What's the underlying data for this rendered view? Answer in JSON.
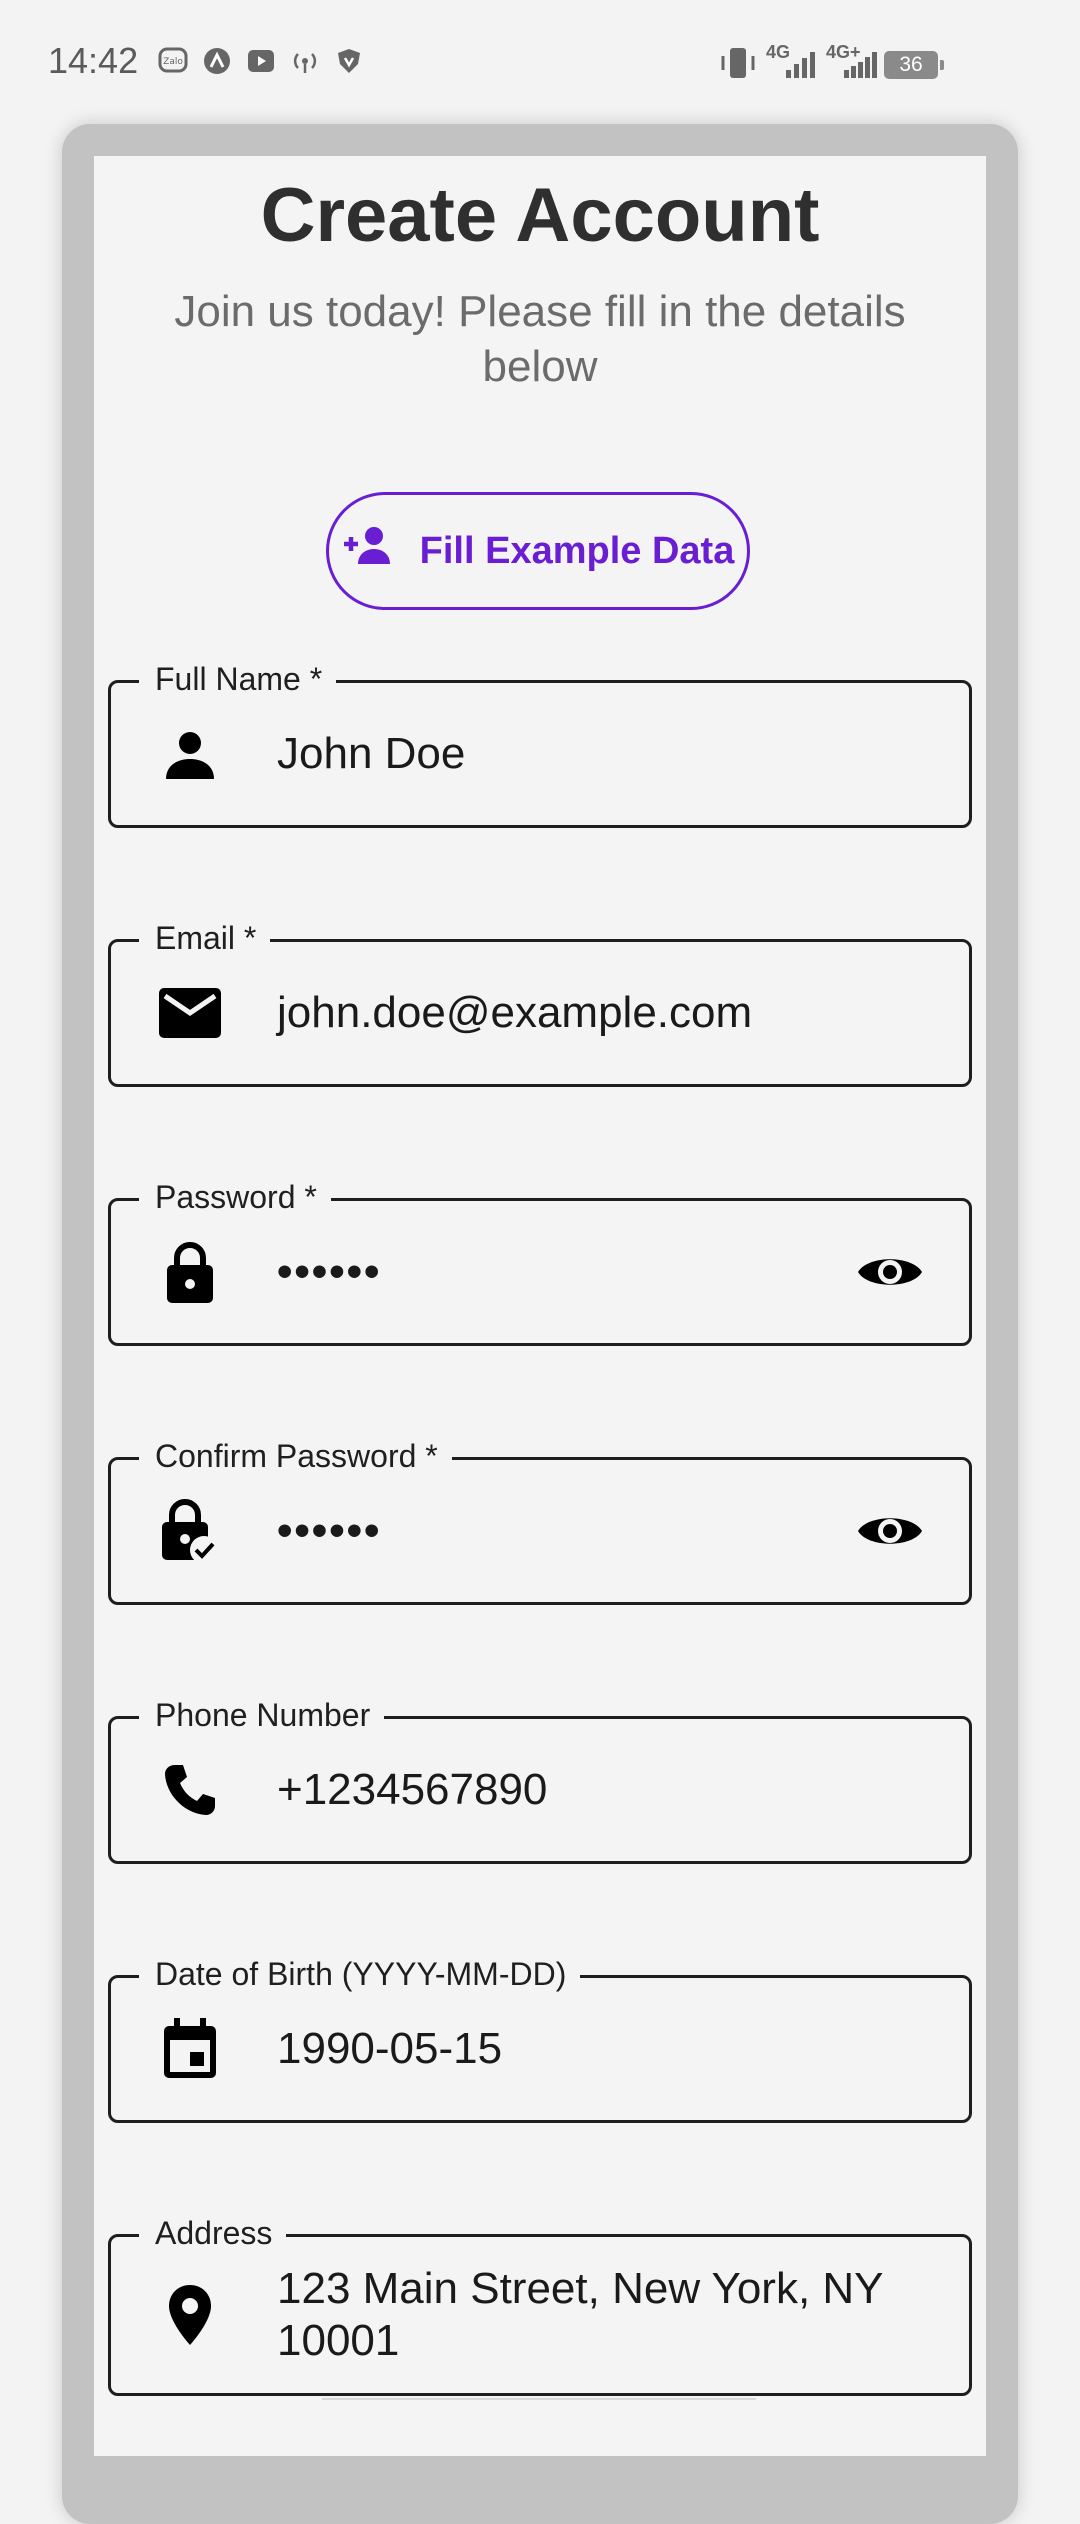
{
  "status": {
    "time": "14:42",
    "battery": "36",
    "net1": "4G",
    "net2": "4G+",
    "zalo_label": "Zalo"
  },
  "header": {
    "title": "Create Account",
    "subtitle": "Join us today! Please fill in the details below"
  },
  "fill_button": {
    "label": "Fill Example Data"
  },
  "fields": [
    {
      "label": "Full Name *",
      "value": "John Doe",
      "icon": "person-icon"
    },
    {
      "label": "Email *",
      "value": "john.doe@example.com",
      "icon": "email-icon"
    },
    {
      "label": "Password *",
      "value": "••••••",
      "icon": "lock-icon"
    },
    {
      "label": "Confirm Password *",
      "value": "••••••",
      "icon": "lock-check-icon"
    },
    {
      "label": "Phone Number",
      "value": "+1234567890",
      "icon": "phone-icon"
    },
    {
      "label": "Date of Birth (YYYY-MM-DD)",
      "value": "1990-05-15",
      "icon": "calendar-icon"
    },
    {
      "label": "Address",
      "value": "123 Main Street, New York, NY 10001",
      "icon": "location-pin-icon"
    }
  ],
  "colors": {
    "accent": "#6a1ed3",
    "background": "#f4f4f4",
    "frame": "#c2c2c2",
    "text": "#1a1a1a"
  }
}
